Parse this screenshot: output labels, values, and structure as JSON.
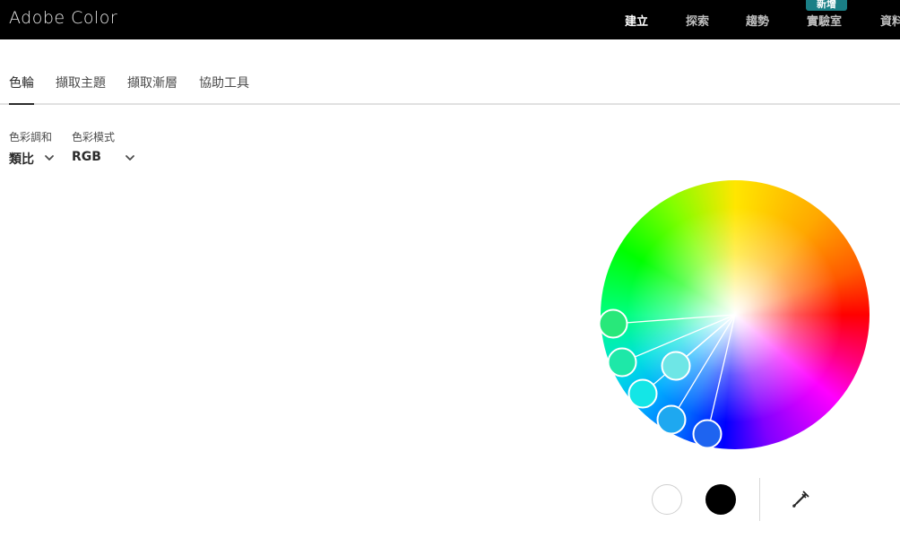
{
  "app": {
    "brand": "Adobe Color"
  },
  "nav": {
    "items": [
      {
        "label": "建立",
        "active": true
      },
      {
        "label": "探索",
        "active": false
      },
      {
        "label": "趨勢",
        "active": false
      },
      {
        "label": "實驗室",
        "active": false
      },
      {
        "label": "資料",
        "active": false
      }
    ],
    "badge": "新增"
  },
  "tabs": [
    {
      "label": "色輪",
      "active": true
    },
    {
      "label": "擷取主題",
      "active": false
    },
    {
      "label": "擷取漸層",
      "active": false
    },
    {
      "label": "協助工具",
      "active": false
    }
  ],
  "controls": {
    "harmony": {
      "label": "色彩調和",
      "value": "類比"
    },
    "mode": {
      "label": "色彩模式",
      "value": "RGB"
    }
  },
  "wheel": {
    "handles": [
      {
        "color": "#28e87a",
        "base": false
      },
      {
        "color": "#1ee8a8",
        "base": false
      },
      {
        "color": "#14e6e6",
        "base": false
      },
      {
        "color": "#1ea8f0",
        "base": false
      },
      {
        "color": "#1e64f0",
        "base": false
      },
      {
        "color": "#6ee6e6",
        "base": true
      }
    ]
  },
  "swatches": {
    "white": "#ffffff",
    "black": "#000000"
  },
  "icons": {
    "eyedropper": "eyedropper-icon",
    "chevron": "chevron-down-icon"
  }
}
